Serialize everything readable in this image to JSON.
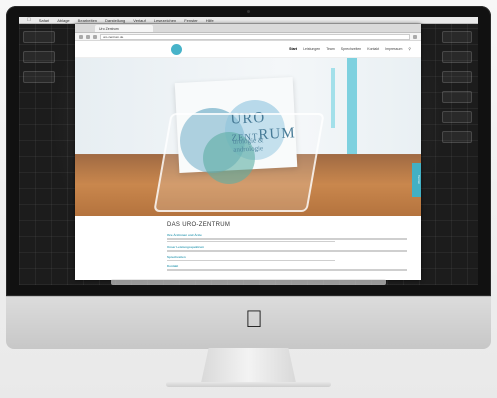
{
  "desktop": {
    "menubar": {
      "apple": "",
      "items": [
        "Safari",
        "Ablage",
        "Bearbeiten",
        "Darstellung",
        "Verlauf",
        "Lesezeichen",
        "Fenster",
        "Hilfe"
      ],
      "clock": ""
    },
    "left_icons": [
      "",
      "",
      ""
    ],
    "right_icons": [
      "",
      "",
      "",
      "",
      "",
      ""
    ]
  },
  "browser": {
    "tab_title": "Uro Zentrum",
    "url": "uro-zentrum.de"
  },
  "site": {
    "nav": [
      "Start",
      "Leistungen",
      "Team",
      "Sprechzeiten",
      "Kontakt",
      "Impressum"
    ],
    "hero": {
      "card_line1": "URO",
      "card_line2": "ZENT",
      "card_line3": "RUM",
      "card_sub1": "urologie &",
      "card_sub2": "andrologie"
    },
    "side_tab": "Termin",
    "content_title": "DAS URO-ZENTRUM",
    "paragraphs": [
      {
        "head": "Ihre Ärztinnen und Ärzte"
      },
      {
        "head": "Unser Leistungsspektrum"
      },
      {
        "head": "Sprechzeiten"
      },
      {
        "head": "Kontakt"
      }
    ]
  },
  "colors": {
    "accent": "#43b0c4",
    "wood": "#b4733e"
  }
}
